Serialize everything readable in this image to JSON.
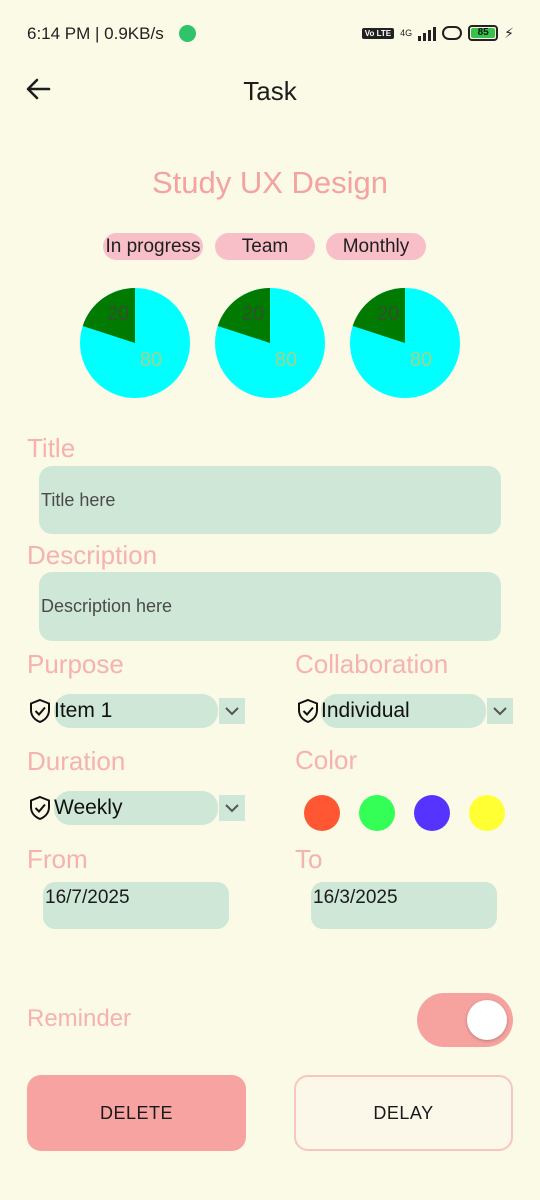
{
  "status_bar": {
    "time_speed": "6:14 PM | 0.9KB/s",
    "volte": "Vo LTE",
    "network": "4G",
    "battery": "85"
  },
  "header": {
    "title": "Task"
  },
  "task": {
    "name": "Study UX Design",
    "chips": [
      "In progress",
      "Team",
      "Monthly"
    ],
    "pies": [
      {
        "small": "20",
        "large": "80"
      },
      {
        "small": "20",
        "large": "80"
      },
      {
        "small": "20",
        "large": "80"
      }
    ]
  },
  "form": {
    "title_label": "Title",
    "title_placeholder": "Title here",
    "description_label": "Description",
    "description_placeholder": "Description here",
    "purpose_label": "Purpose",
    "purpose_value": "Item 1",
    "collaboration_label": "Collaboration",
    "collaboration_value": "Individual",
    "duration_label": "Duration",
    "duration_value": "Weekly",
    "color_label": "Color",
    "colors": [
      "#ff5733",
      "#33ff57",
      "#5733ff",
      "#ffff33"
    ],
    "from_label": "From",
    "from_value": "16/7/2025",
    "to_label": "To",
    "to_value": "16/3/2025",
    "reminder_label": "Reminder",
    "reminder_on": true
  },
  "actions": {
    "delete": "DELETE",
    "delay": "DELAY"
  },
  "theme": {
    "background": "#fafae6",
    "accent": "#f4a3a0",
    "field": "#cfe7d7",
    "chip": "#f8bfc8",
    "pie_large": "#00ffff",
    "pie_small": "#007a00"
  }
}
